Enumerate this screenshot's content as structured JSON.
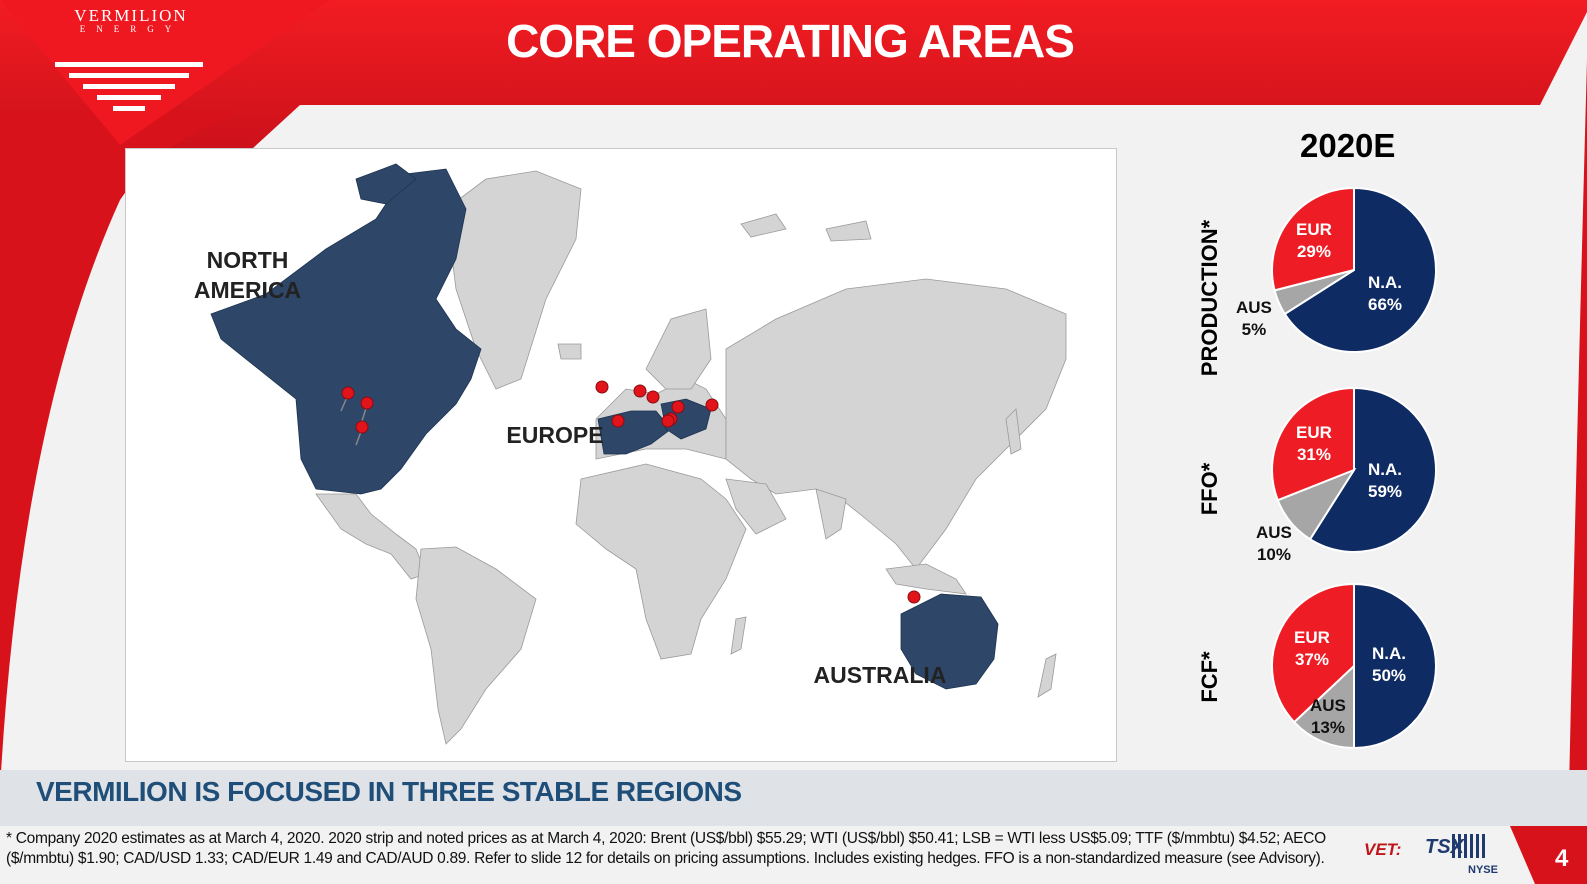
{
  "header": {
    "title": "CORE OPERATING AREAS",
    "logo_name": "VERMILION",
    "logo_sub": "ENERGY",
    "brand_color": "#e1141b"
  },
  "map": {
    "regions": [
      {
        "label_line1": "NORTH",
        "label_line2": "AMERICA"
      },
      {
        "label_line1": "EUROPE",
        "label_line2": ""
      },
      {
        "label_line1": "AUSTRALIA",
        "label_line2": ""
      }
    ],
    "highlight_color": "#2e4668",
    "land_color": "#d4d4d4"
  },
  "chart_data": [
    {
      "type": "pie",
      "title": "PRODUCTION*",
      "period": "2020E",
      "slices": [
        {
          "label": "N.A.",
          "value": 66,
          "color": "#0f2b63"
        },
        {
          "label": "AUS",
          "value": 5,
          "color": "#a6a6a6"
        },
        {
          "label": "EUR",
          "value": 29,
          "color": "#ee1c25"
        }
      ],
      "label_text": {
        "na": "66%",
        "aus": "5%",
        "eur": "29%"
      }
    },
    {
      "type": "pie",
      "title": "FFO*",
      "period": "2020E",
      "slices": [
        {
          "label": "N.A.",
          "value": 59,
          "color": "#0f2b63"
        },
        {
          "label": "AUS",
          "value": 10,
          "color": "#a6a6a6"
        },
        {
          "label": "EUR",
          "value": 31,
          "color": "#ee1c25"
        }
      ],
      "label_text": {
        "na": "59%",
        "aus": "10%",
        "eur": "31%"
      }
    },
    {
      "type": "pie",
      "title": "FCF*",
      "period": "2020E",
      "slices": [
        {
          "label": "N.A.",
          "value": 50,
          "color": "#0f2b63"
        },
        {
          "label": "AUS",
          "value": 13,
          "color": "#a6a6a6"
        },
        {
          "label": "EUR",
          "value": 37,
          "color": "#ee1c25"
        }
      ],
      "label_text": {
        "na": "50%",
        "aus": "13%",
        "eur": "37%"
      }
    }
  ],
  "year_label": "2020E",
  "tagline": "VERMILION IS FOCUSED IN THREE STABLE REGIONS",
  "footnote": "* Company 2020 estimates as at March 4, 2020. 2020 strip and noted prices as at March 4, 2020: Brent (US$/bbl) $55.29; WTI (US$/bbl) $50.41; LSB = WTI less US$5.09; TTF ($/mmbtu) $4.52; AECO ($/mmbtu) $1.90; CAD/USD 1.33; CAD/EUR 1.49 and CAD/AUD 0.89.  Refer to slide 12 for details on pricing assumptions. Includes existing hedges.  FFO is a non-standardized measure (see Advisory).",
  "footer": {
    "ticker": "VET:",
    "exchange1": "TSX",
    "exchange2": "NYSE",
    "page_number": "4"
  }
}
